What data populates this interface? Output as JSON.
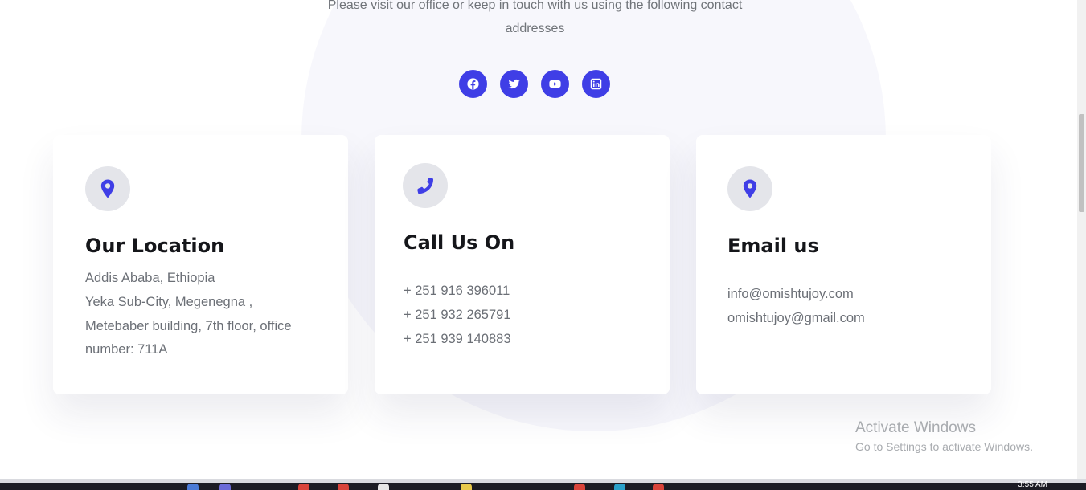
{
  "intro": {
    "line1": "Please visit our office or keep in touch with us using the following contact",
    "line2": "addresses"
  },
  "socials": [
    {
      "icon": "facebook-icon"
    },
    {
      "icon": "twitter-icon"
    },
    {
      "icon": "youtube-icon"
    },
    {
      "icon": "linkedin-icon"
    }
  ],
  "cards": {
    "location": {
      "icon": "map-pin-icon",
      "title": "Our Location",
      "lines": [
        "Addis Ababa, Ethiopia",
        "Yeka Sub-City, Megenegna ,",
        "Metebaber building, 7th floor, office",
        "number: 711A"
      ]
    },
    "call": {
      "icon": "phone-icon",
      "title": "Call Us On",
      "lines": [
        "+ 251 916 396011",
        "+ 251 932 265791",
        "+ 251 939 140883"
      ]
    },
    "email": {
      "icon": "map-pin-icon",
      "title": "Email us",
      "lines": [
        "info@omishtujoy.com",
        "omishtujoy@gmail.com"
      ]
    }
  },
  "watermark": {
    "title": "Activate Windows",
    "subtitle": "Go to Settings to activate Windows."
  },
  "taskbar": {
    "clock": "3:55 AM"
  },
  "colors": {
    "accent": "#3f3ee6",
    "icon_bg": "#e4e5ea",
    "heading": "#15161a",
    "body_text": "#6b6f76"
  }
}
